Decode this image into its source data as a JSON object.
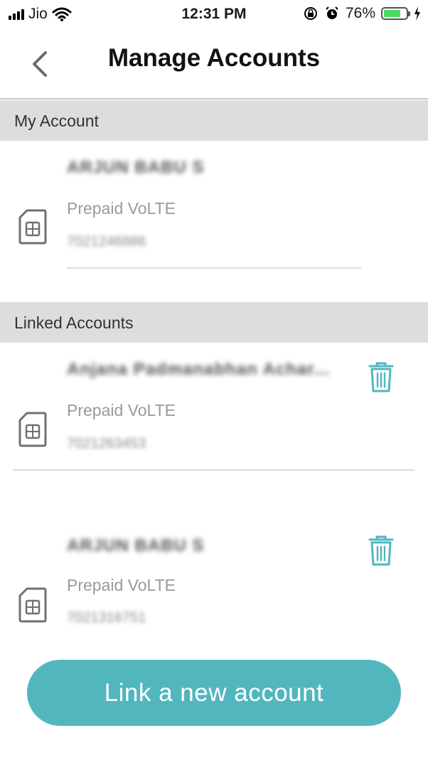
{
  "status_bar": {
    "carrier": "Jio",
    "time": "12:31 PM",
    "battery_percent": "76%",
    "battery_level": 0.76,
    "icons": [
      "signal-icon",
      "wifi-icon",
      "rotation-lock-icon",
      "alarm-icon",
      "battery-icon",
      "charging-icon"
    ]
  },
  "nav": {
    "title": "Manage Accounts",
    "back_icon": "chevron-left-icon"
  },
  "my_account": {
    "header": "My Account",
    "item": {
      "name": "ARJUN BABU S",
      "plan": "Prepaid VoLTE",
      "number": "7021246886"
    }
  },
  "linked_accounts": {
    "header": "Linked Accounts",
    "items": [
      {
        "name": "Anjana Padmanabhan Achar...",
        "plan": "Prepaid VoLTE",
        "number": "7021263453"
      },
      {
        "name": "ARJUN BABU S",
        "plan": "Prepaid VoLTE",
        "number": "7021316751"
      }
    ]
  },
  "cta": {
    "label": "Link a new account"
  },
  "colors": {
    "accent": "#52b6bf",
    "section_bg": "#dddddd",
    "battery": "#4cd964"
  }
}
